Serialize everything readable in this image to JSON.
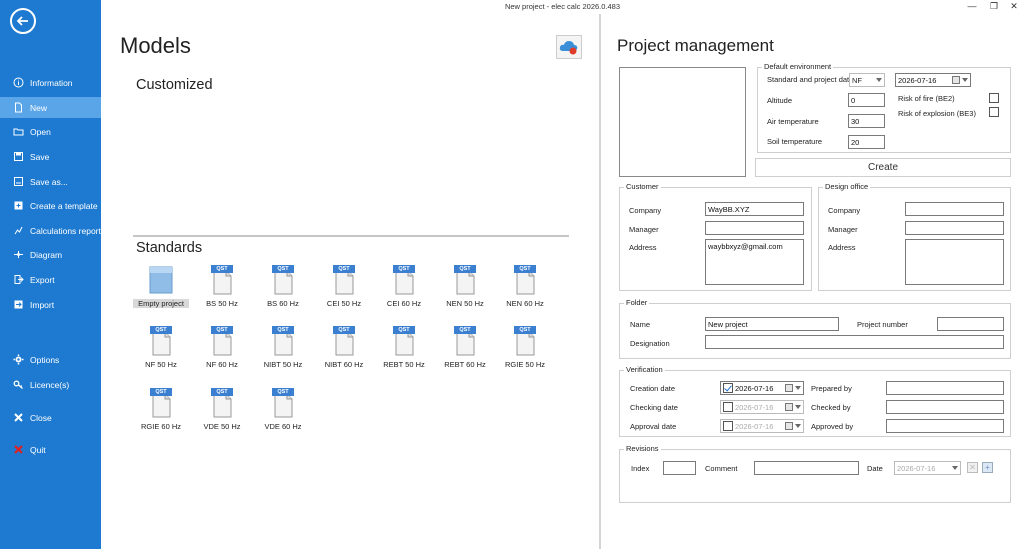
{
  "window": {
    "title": "New project - elec calc 2026.0.483",
    "minimize": "—",
    "restore": "❐",
    "close": "✕"
  },
  "sidebar": {
    "items": [
      {
        "label": "Information",
        "icon": "info-icon"
      },
      {
        "label": "New",
        "icon": "new-icon"
      },
      {
        "label": "Open",
        "icon": "open-folder-icon"
      },
      {
        "label": "Save",
        "icon": "save-icon"
      },
      {
        "label": "Save as...",
        "icon": "save-as-icon"
      },
      {
        "label": "Create a template",
        "icon": "template-icon"
      },
      {
        "label": "Calculations report",
        "icon": "report-icon"
      },
      {
        "label": "Diagram",
        "icon": "diagram-icon"
      },
      {
        "label": "Export",
        "icon": "export-icon"
      },
      {
        "label": "Import",
        "icon": "import-icon"
      },
      {
        "label": "Options",
        "icon": "gear-icon"
      },
      {
        "label": "Licence(s)",
        "icon": "key-icon"
      },
      {
        "label": "Close",
        "icon": "close-icon"
      },
      {
        "label": "Quit",
        "icon": "quit-icon"
      }
    ],
    "active": "New"
  },
  "models": {
    "title": "Models",
    "customized": "Customized",
    "standards": "Standards",
    "templates": [
      {
        "label": "Empty project",
        "badge": ""
      },
      {
        "label": "BS 50 Hz",
        "badge": "QST"
      },
      {
        "label": "BS 60 Hz",
        "badge": "QST"
      },
      {
        "label": "CEI 50 Hz",
        "badge": "QST"
      },
      {
        "label": "CEI 60 Hz",
        "badge": "QST"
      },
      {
        "label": "NEN 50 Hz",
        "badge": "QST"
      },
      {
        "label": "NEN 60 Hz",
        "badge": "QST"
      },
      {
        "label": "NF 50 Hz",
        "badge": "QST"
      },
      {
        "label": "NF 60 Hz",
        "badge": "QST"
      },
      {
        "label": "NIBT 50 Hz",
        "badge": "QST"
      },
      {
        "label": "NIBT 60 Hz",
        "badge": "QST"
      },
      {
        "label": "REBT 50 Hz",
        "badge": "QST"
      },
      {
        "label": "REBT 60 Hz",
        "badge": "QST"
      },
      {
        "label": "RGIE 50 Hz",
        "badge": "QST"
      },
      {
        "label": "RGIE 60 Hz",
        "badge": "QST"
      },
      {
        "label": "VDE 50 Hz",
        "badge": "QST"
      },
      {
        "label": "VDE 60 Hz",
        "badge": "QST"
      }
    ]
  },
  "pm": {
    "title": "Project management",
    "env": {
      "title": "Default environment",
      "standard_label": "Standard and project date",
      "standard_value": "NF",
      "date_value": "2026-07-16",
      "altitude_label": "Altitude",
      "altitude_value": "0",
      "air_label": "Air temperature",
      "air_value": "30",
      "soil_label": "Soil temperature",
      "soil_value": "20",
      "fire_label": "Risk of fire (BE2)",
      "fire_checked": false,
      "explosion_label": "Risk of explosion (BE3)",
      "explosion_checked": false
    },
    "create_label": "Create",
    "customer": {
      "title": "Customer",
      "company_label": "Company",
      "company_value": "WayBB.XYZ",
      "manager_label": "Manager",
      "manager_value": "",
      "address_label": "Address",
      "address_value": "waybbxyz@gmail.com"
    },
    "design": {
      "title": "Design office",
      "company_label": "Company",
      "company_value": "",
      "manager_label": "Manager",
      "manager_value": "",
      "address_label": "Address",
      "address_value": ""
    },
    "folder": {
      "title": "Folder",
      "name_label": "Name",
      "name_value": "New project",
      "number_label": "Project number",
      "number_value": "",
      "designation_label": "Designation",
      "designation_value": ""
    },
    "verification": {
      "title": "Verification",
      "creation_label": "Creation date",
      "creation_value": "2026-07-16",
      "creation_checked": true,
      "checking_label": "Checking date",
      "checking_value": "2026-07-16",
      "checking_checked": false,
      "approval_label": "Approval date",
      "approval_value": "2026-07-16",
      "approval_checked": false,
      "prepared_label": "Prepared by",
      "prepared_value": "",
      "checked_label": "Checked by",
      "checked_value": "",
      "approved_label": "Approved by",
      "approved_value": ""
    },
    "revisions": {
      "title": "Revisions",
      "index_label": "Index",
      "index_value": "",
      "comment_label": "Comment",
      "comment_value": "",
      "date_label": "Date",
      "date_value": "2026-07-16",
      "delete_glyph": "✕",
      "add_glyph": "+"
    }
  }
}
